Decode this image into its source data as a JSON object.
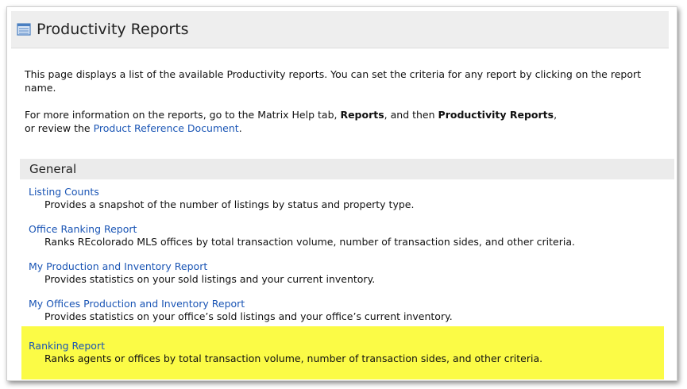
{
  "header": {
    "title": "Productivity Reports"
  },
  "intro": {
    "para1": "This page displays a list of the available Productivity reports. You can set the criteria for any report by clicking on the report name.",
    "para2_prefix": "For more information on the reports, go to the Matrix Help tab, ",
    "para2_bold1": "Reports",
    "para2_mid": ", and then ",
    "para2_bold2": "Productivity Reports",
    "para2_suffix": ",",
    "para2_line2_prefix": "or review the ",
    "para2_link": "Product Reference Document",
    "para2_end": "."
  },
  "section": {
    "title": "General"
  },
  "reports": [
    {
      "name": "Listing Counts",
      "description": "Provides a snapshot of the number of listings by status and property type."
    },
    {
      "name": "Office Ranking Report",
      "description": "Ranks REcolorado MLS offices by total transaction volume, number of transaction sides, and other criteria."
    },
    {
      "name": "My Production and Inventory Report",
      "description": "Provides statistics on your sold listings and your current inventory."
    },
    {
      "name": "My Offices Production and Inventory Report",
      "description": "Provides statistics on your office’s sold listings and your office’s current inventory."
    },
    {
      "name": "Ranking Report",
      "description": "Ranks agents or offices by total transaction volume, number of transaction sides, and other criteria."
    }
  ],
  "colors": {
    "link": "#1a55b5",
    "highlight": "#fbfb46",
    "icon": "#4a7fc1"
  },
  "icons": {
    "title_icon": "report-list-icon"
  }
}
